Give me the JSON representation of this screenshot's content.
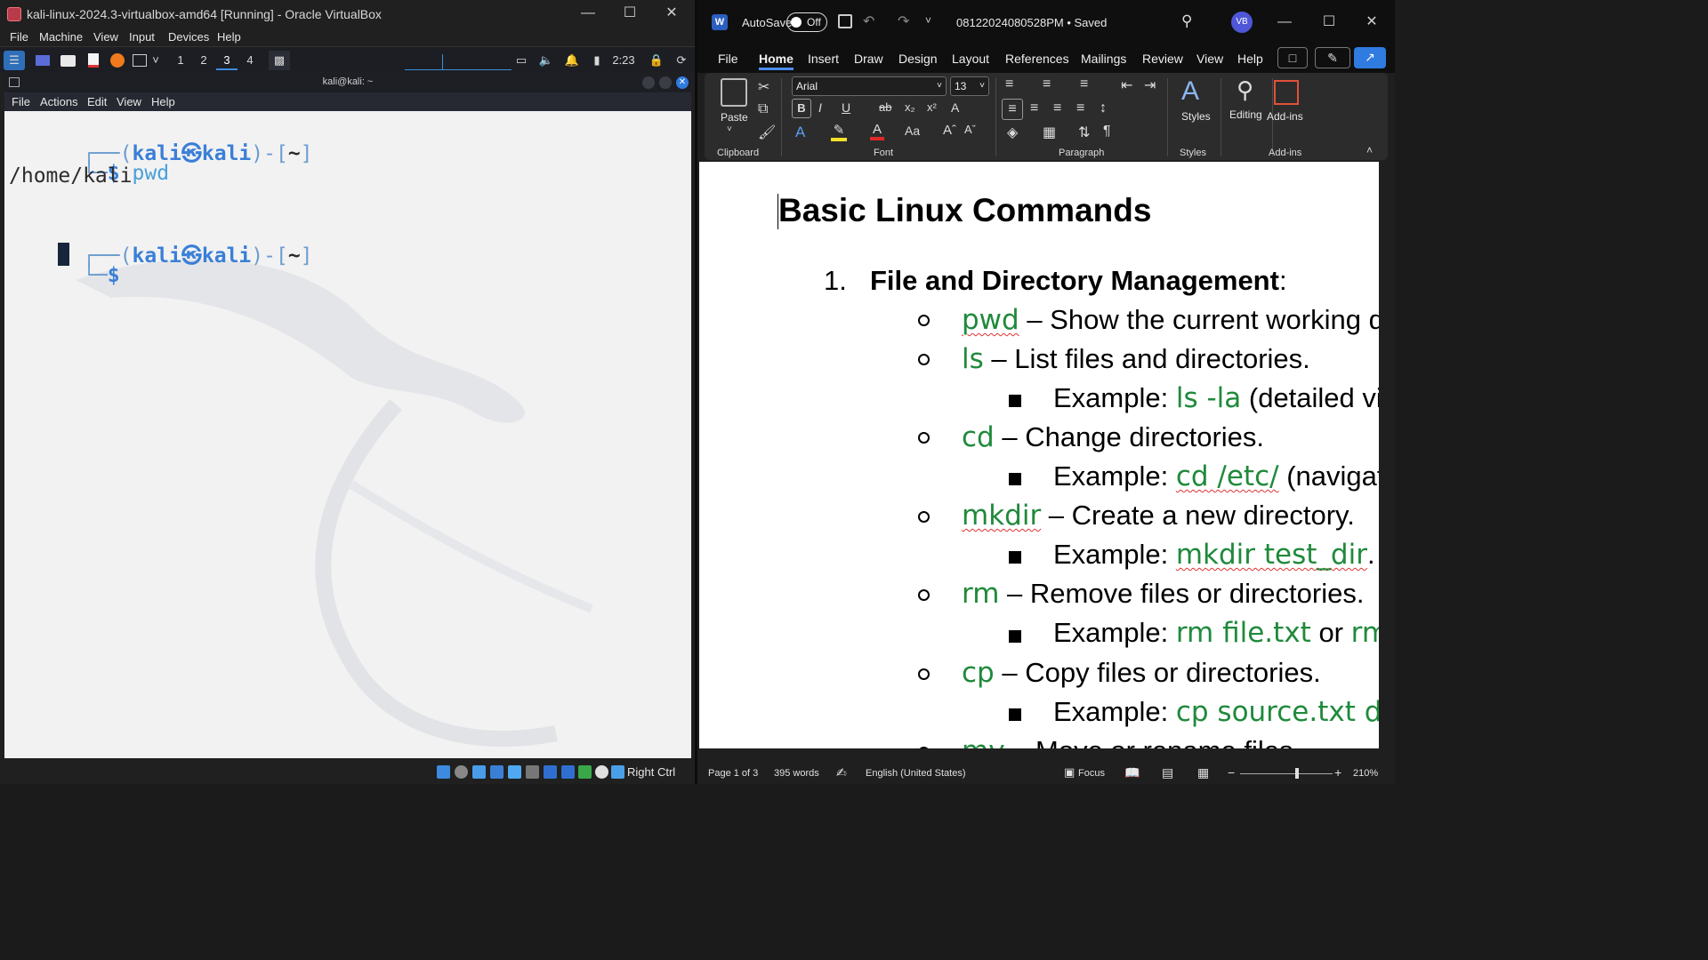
{
  "vbox": {
    "title": "kali-linux-2024.3-virtualbox-amd64 [Running] - Oracle VirtualBox",
    "menu": [
      "File",
      "Machine",
      "View",
      "Input",
      "Devices",
      "Help"
    ],
    "status_host_key": "Right Ctrl"
  },
  "kali_panel": {
    "workspaces": [
      "1",
      "2",
      "3",
      "4"
    ],
    "active_workspace": "3",
    "clock": "2:23"
  },
  "terminal": {
    "title": "kali@kali: ~",
    "menu": [
      "File",
      "Actions",
      "Edit",
      "View",
      "Help"
    ],
    "prompt_user": "kali",
    "prompt_host": "kali",
    "prompt_dir": "~",
    "lines": {
      "cmd1": "pwd",
      "out1": "/home/kali"
    }
  },
  "word": {
    "autosave_label": "AutoSave",
    "autosave_state": "Off",
    "doc_title": "08122024080528PM • Saved",
    "avatar": "VB",
    "tabs": [
      "File",
      "Home",
      "Insert",
      "Draw",
      "Design",
      "Layout",
      "References",
      "Mailings",
      "Review",
      "View",
      "Help"
    ],
    "active_tab": "Home",
    "ribbon": {
      "paste": "Paste",
      "font_name": "Arial",
      "font_size": "13",
      "styles": "Styles",
      "editing": "Editing",
      "addins": "Add-ins",
      "group_labels": [
        "Clipboard",
        "Font",
        "Paragraph",
        "Styles",
        "Add-ins"
      ]
    },
    "document": {
      "heading": "Basic Linux Commands",
      "section_number": "1.",
      "section_title": "File and Directory Management",
      "section_colon": ":",
      "items": [
        {
          "cmd": "pwd",
          "desc": " – Show the current working d"
        },
        {
          "cmd": "ls",
          "desc": " – List files and directories."
        },
        {
          "example_label": "Example: ",
          "example_code": "ls -la",
          "example_rest": " (detailed vie"
        },
        {
          "cmd": "cd",
          "desc": " – Change directories."
        },
        {
          "example_label": "Example: ",
          "example_code": "cd /etc/",
          "example_rest": " (navigate"
        },
        {
          "cmd": "mkdir",
          "desc": " – Create a new directory."
        },
        {
          "example_label": "Example: ",
          "example_code": "mkdir test_dir",
          "example_rest": "."
        },
        {
          "cmd": "rm",
          "desc": " – Remove files or directories."
        },
        {
          "example_label": "Example: ",
          "example_code": "rm file.txt",
          "example_rest": " or ",
          "example_code2": "rm -"
        },
        {
          "cmd": "cp",
          "desc": " – Copy files or directories."
        },
        {
          "example_label": "Example: ",
          "example_code": "cp source.txt dest"
        },
        {
          "cmd": "mv",
          "desc": " – Move or rename files."
        }
      ]
    },
    "status": {
      "page": "Page 1 of 3",
      "words": "395 words",
      "language": "English (United States)",
      "focus": "Focus",
      "zoom": "210%"
    }
  }
}
